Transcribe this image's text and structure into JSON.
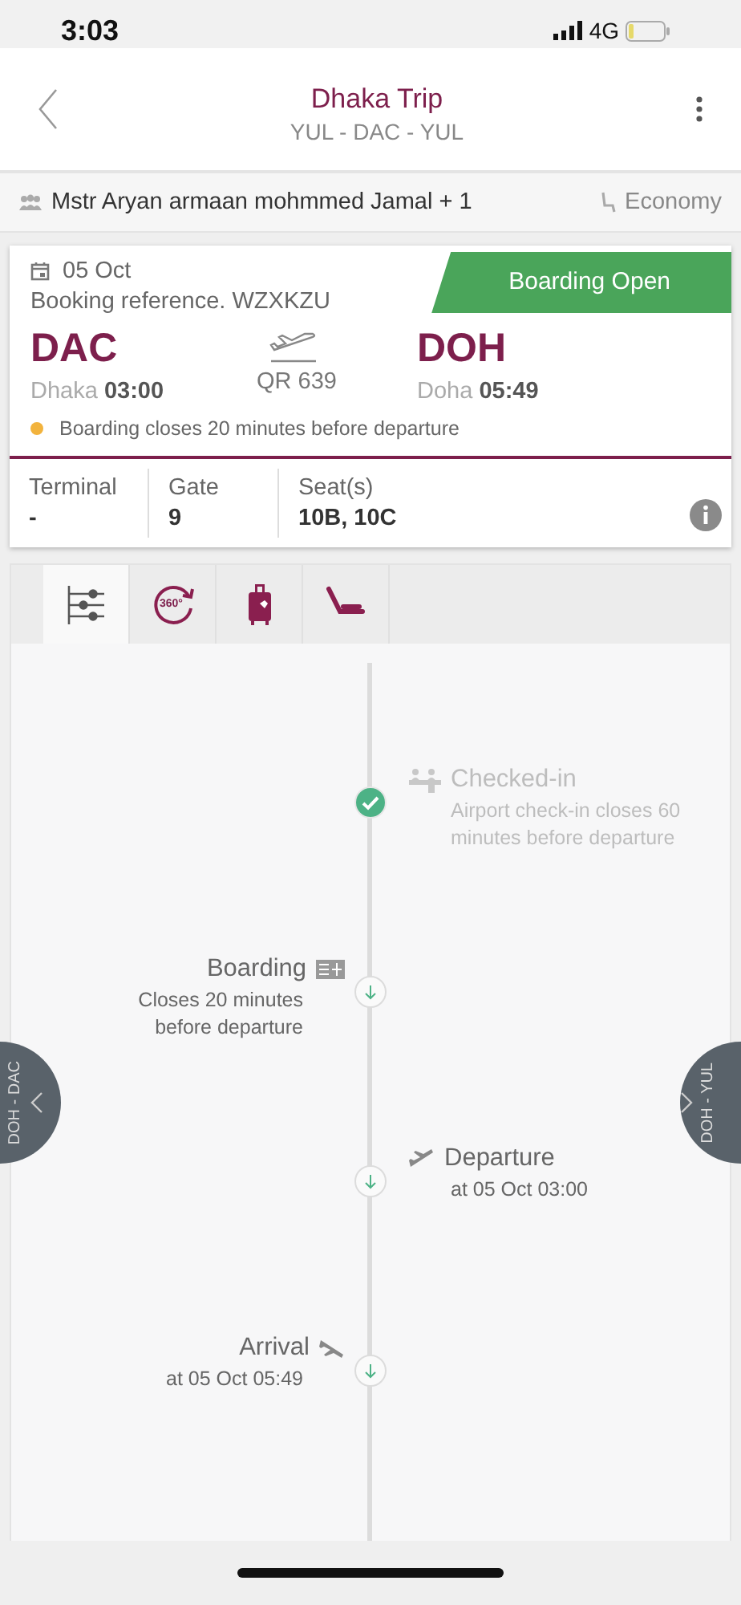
{
  "status_bar": {
    "time": "3:03",
    "network": "4G"
  },
  "header": {
    "title": "Dhaka Trip",
    "route": "YUL - DAC - YUL"
  },
  "passenger_bar": {
    "passengers": "Mstr Aryan armaan mohmmed Jamal + 1",
    "cabin": "Economy"
  },
  "flight_card": {
    "date": "05 Oct",
    "booking_reference": "Booking reference. WZXKZU",
    "status": "Boarding Open",
    "origin": {
      "code": "DAC",
      "city": "Dhaka",
      "time": "03:00"
    },
    "flight_number": "QR 639",
    "destination": {
      "code": "DOH",
      "city": "Doha",
      "time": "05:49"
    },
    "note": {
      "text": "Boarding closes 20 minutes before departure",
      "color": "#f2b33d"
    },
    "details": [
      {
        "label": "Terminal",
        "value": "-"
      },
      {
        "label": "Gate",
        "value": "9"
      },
      {
        "label": "Seat(s)",
        "value": "10B, 10C"
      }
    ]
  },
  "tabs": [
    {
      "selected": true
    },
    {
      "label": "360°",
      "selected": false
    },
    {
      "selected": false
    },
    {
      "selected": false
    }
  ],
  "timeline": [
    {
      "title": "Checked-in",
      "note": "Airport check-in closes 60 minutes before departure",
      "done": true
    },
    {
      "title": "Boarding",
      "note": "Closes 20 minutes before departure",
      "done": false
    },
    {
      "title": "Departure",
      "note": "at 05 Oct 03:00",
      "done": false
    },
    {
      "title": "Arrival",
      "note": "at 05 Oct 05:49",
      "done": false
    }
  ],
  "side_tabs": {
    "previous": "DOH - DAC",
    "next": "DOH - YUL"
  }
}
